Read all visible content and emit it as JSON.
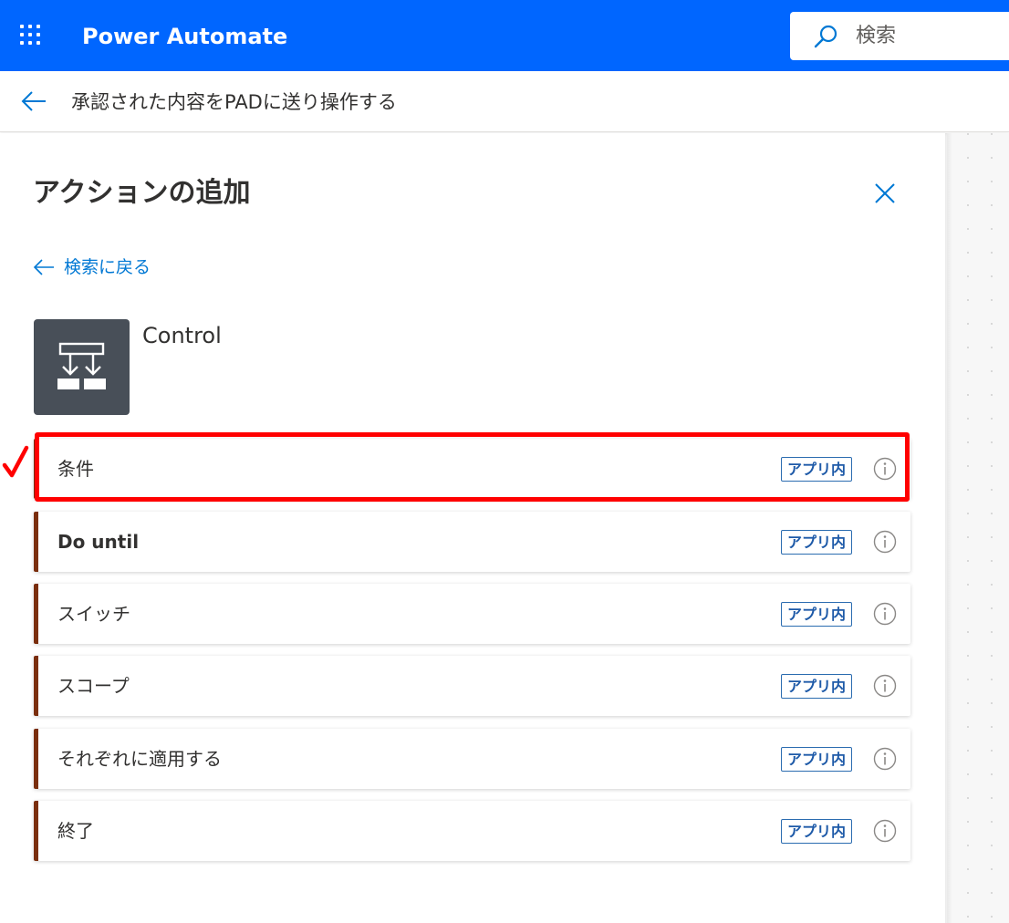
{
  "header": {
    "app_name": "Power Automate",
    "brand_color": "#0066ff",
    "search": {
      "placeholder": "検索"
    }
  },
  "subheader": {
    "flow_title": "承認された内容をPADに送り操作する"
  },
  "panel": {
    "title": "アクションの追加",
    "back_link": "検索に戻る",
    "connector": {
      "name": "Control",
      "icon": "control-flow-icon"
    },
    "actions": [
      {
        "label": "条件",
        "badge": "アプリ内",
        "highlighted": true
      },
      {
        "label": "Do until",
        "badge": "アプリ内"
      },
      {
        "label": "スイッチ",
        "badge": "アプリ内"
      },
      {
        "label": "スコープ",
        "badge": "アプリ内"
      },
      {
        "label": "それぞれに適用する",
        "badge": "アプリ内"
      },
      {
        "label": "終了",
        "badge": "アプリ内"
      }
    ]
  },
  "annotation": {
    "highlight_color": "#ff0000"
  }
}
